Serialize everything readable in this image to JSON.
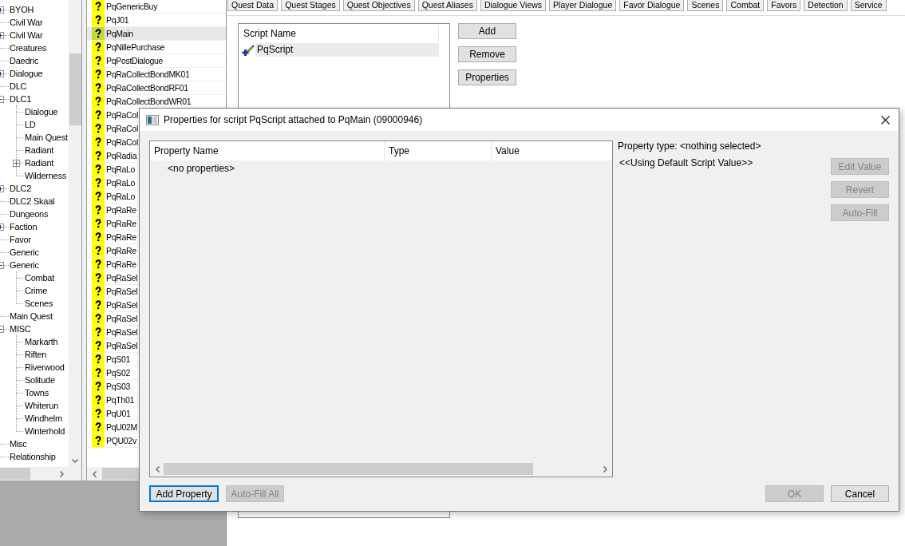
{
  "category_tree": {
    "items": [
      {
        "label": "BYOH",
        "expanded": false
      },
      {
        "label": "Civil War"
      },
      {
        "label": "Civil War",
        "expanded": false
      },
      {
        "label": "Creatures"
      },
      {
        "label": "Daedric"
      },
      {
        "label": "Dialogue",
        "expanded": false
      },
      {
        "label": "DLC"
      },
      {
        "label": "DLC1",
        "expanded": true,
        "children": [
          {
            "label": "Dialogue"
          },
          {
            "label": "LD"
          },
          {
            "label": "Main Quest"
          },
          {
            "label": "Radiant"
          },
          {
            "label": "Radiant",
            "expanded": false
          },
          {
            "label": "Wilderness"
          }
        ]
      },
      {
        "label": "DLC2",
        "expanded": false
      },
      {
        "label": "DLC2 Skaal"
      },
      {
        "label": "Dungeons"
      },
      {
        "label": "Faction",
        "expanded": false
      },
      {
        "label": "Favor"
      },
      {
        "label": "Generic"
      },
      {
        "label": "Generic",
        "expanded": true,
        "children": [
          {
            "label": "Combat"
          },
          {
            "label": "Crime"
          },
          {
            "label": "Scenes"
          }
        ]
      },
      {
        "label": "Main Quest"
      },
      {
        "label": "MISC",
        "expanded": true,
        "children": [
          {
            "label": "Markarth"
          },
          {
            "label": "Riften"
          },
          {
            "label": "Riverwood"
          },
          {
            "label": "Solitude"
          },
          {
            "label": "Towns"
          },
          {
            "label": "Whiterun"
          },
          {
            "label": "Windhelm"
          },
          {
            "label": "Winterhold"
          }
        ]
      },
      {
        "label": "Misc"
      },
      {
        "label": "Relationship"
      }
    ]
  },
  "quest_list": {
    "rows": [
      {
        "name": "PqGenericBuy",
        "selected": false
      },
      {
        "name": "PqJ01",
        "selected": false
      },
      {
        "name": "PqMain",
        "selected": true
      },
      {
        "name": "PqNillePurchase",
        "selected": false
      },
      {
        "name": "PqPostDialogue",
        "selected": false
      },
      {
        "name": "PqRaCollectBondMK01",
        "selected": false
      },
      {
        "name": "PqRaCollectBondRF01",
        "selected": false
      },
      {
        "name": "PqRaCollectBondWR01",
        "selected": false
      },
      {
        "name": "PqRaCol",
        "selected": false
      },
      {
        "name": "PqRaCol",
        "selected": false
      },
      {
        "name": "PqRaCol",
        "selected": false
      },
      {
        "name": "PqRadia",
        "selected": false
      },
      {
        "name": "PqRaLo",
        "selected": false
      },
      {
        "name": "PqRaLo",
        "selected": false
      },
      {
        "name": "PqRaLo",
        "selected": false
      },
      {
        "name": "PqRaRe",
        "selected": false
      },
      {
        "name": "PqRaRe",
        "selected": false
      },
      {
        "name": "PqRaRe",
        "selected": false
      },
      {
        "name": "PqRaRe",
        "selected": false
      },
      {
        "name": "PqRaRe",
        "selected": false
      },
      {
        "name": "PqRaSel",
        "selected": false
      },
      {
        "name": "PqRaSel",
        "selected": false
      },
      {
        "name": "PqRaSel",
        "selected": false
      },
      {
        "name": "PqRaSel",
        "selected": false
      },
      {
        "name": "PqRaSel",
        "selected": false
      },
      {
        "name": "PqRaSel",
        "selected": false
      },
      {
        "name": "PqS01",
        "selected": false
      },
      {
        "name": "PqS02",
        "selected": false
      },
      {
        "name": "PqS03",
        "selected": false
      },
      {
        "name": "PqTh01",
        "selected": false
      },
      {
        "name": "PqU01",
        "selected": false
      },
      {
        "name": "PqU02M",
        "selected": false
      },
      {
        "name": "PQU02v",
        "selected": false
      }
    ]
  },
  "quest_window": {
    "tabs": [
      {
        "label": "Quest Data",
        "selected": false
      },
      {
        "label": "Quest Stages",
        "selected": false
      },
      {
        "label": "Quest Objectives",
        "selected": false
      },
      {
        "label": "Quest Aliases",
        "selected": false
      },
      {
        "label": "Dialogue Views",
        "selected": false
      },
      {
        "label": "Player Dialogue",
        "selected": false
      },
      {
        "label": "Favor Dialogue",
        "selected": false
      },
      {
        "label": "Scenes",
        "selected": false
      },
      {
        "label": "Combat",
        "selected": false
      },
      {
        "label": "Favors",
        "selected": false
      },
      {
        "label": "Detection",
        "selected": false
      },
      {
        "label": "Service",
        "selected": false
      }
    ],
    "scripts": {
      "column": "Script Name",
      "rows": [
        {
          "name": "PqScript",
          "selected": true
        }
      ]
    },
    "buttons": [
      "Add",
      "Remove",
      "Properties"
    ]
  },
  "properties_dialog": {
    "title": "Properties for script PqScript attached to PqMain (09000946)",
    "table": {
      "columns": [
        "Property Name",
        "Type",
        "Value"
      ],
      "empty_text": "<no properties>"
    },
    "property_type": "Property type: <nothing selected>",
    "value_note": "<<Using Default Script Value>>",
    "side_buttons": [
      {
        "label": "Edit Value",
        "disabled": true
      },
      {
        "label": "Revert",
        "disabled": true
      },
      {
        "label": "Auto-Fill",
        "disabled": true
      }
    ],
    "footer_left": [
      {
        "label": "Add Property",
        "disabled": false,
        "focused": true
      },
      {
        "label": "Auto-Fill All",
        "disabled": true,
        "focused": false
      }
    ],
    "footer_right": [
      {
        "label": "OK",
        "disabled": true,
        "focused": false
      },
      {
        "label": "Cancel",
        "disabled": false,
        "focused": false
      }
    ]
  }
}
